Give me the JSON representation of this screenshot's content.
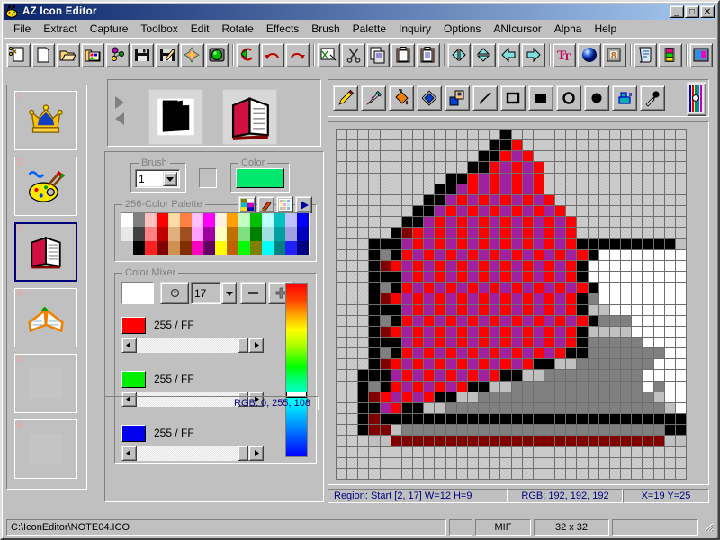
{
  "window": {
    "title": "AZ Icon Editor",
    "icon": "palette-bug-icon",
    "minimize_label": "_",
    "maximize_label": "□",
    "close_label": "✕"
  },
  "menubar": {
    "items": [
      {
        "label": "File",
        "accel": "F"
      },
      {
        "label": "Extract",
        "accel": "x"
      },
      {
        "label": "Capture",
        "accel": "C"
      },
      {
        "label": "Toolbox",
        "accel": "T"
      },
      {
        "label": "Edit",
        "accel": "E"
      },
      {
        "label": "Rotate",
        "accel": "R"
      },
      {
        "label": "Effects",
        "accel": "c"
      },
      {
        "label": "Brush",
        "accel": "B"
      },
      {
        "label": "Palette",
        "accel": "P"
      },
      {
        "label": "Inquiry",
        "accel": "I"
      },
      {
        "label": "Options",
        "accel": "O"
      },
      {
        "label": "ANIcursor",
        "accel": ""
      },
      {
        "label": "Alpha",
        "accel": ""
      },
      {
        "label": "Help",
        "accel": "H"
      }
    ]
  },
  "toolbar": {
    "buttons": [
      {
        "name": "new-icon-button",
        "icon": "new-doc-scissors-icon"
      },
      {
        "name": "new-file-button",
        "icon": "blank-page-icon"
      },
      {
        "name": "open-button",
        "icon": "open-folder-icon"
      },
      {
        "name": "open-library-button",
        "icon": "folder-images-icon"
      },
      {
        "name": "molecule-button",
        "icon": "molecule-icon"
      },
      {
        "name": "save-button",
        "icon": "floppy-disk-icon"
      },
      {
        "name": "save-as-button",
        "icon": "floppy-disk-pencil-icon"
      },
      {
        "name": "effects-button",
        "icon": "fireworks-icon"
      },
      {
        "name": "capture-button",
        "icon": "green-gem-icon"
      },
      {
        "name": "revert-button",
        "icon": "green-undo-arrow-icon"
      },
      {
        "name": "undo-button",
        "icon": "undo-arrow-icon"
      },
      {
        "name": "redo-button",
        "icon": "redo-arrow-icon"
      },
      {
        "name": "cut-region-button",
        "icon": "image-scissors-icon"
      },
      {
        "name": "cut-button",
        "icon": "scissors-icon"
      },
      {
        "name": "copy-button",
        "icon": "copy-pages-icon"
      },
      {
        "name": "paste-button",
        "icon": "clipboard-icon"
      },
      {
        "name": "paste-special-button",
        "icon": "clipboard-text-icon"
      },
      {
        "name": "flip-horizontal-button",
        "icon": "flip-horizontal-icon"
      },
      {
        "name": "flip-vertical-button",
        "icon": "flip-vertical-icon"
      },
      {
        "name": "rotate-left-button",
        "icon": "arrow-left-icon"
      },
      {
        "name": "rotate-right-button",
        "icon": "arrow-right-icon"
      },
      {
        "name": "text-tool-button",
        "icon": "text-tt-icon"
      },
      {
        "name": "sphere-button",
        "icon": "blue-sphere-icon"
      },
      {
        "name": "bit-depth-button",
        "icon": "eight-bit-icon"
      },
      {
        "name": "script-button",
        "icon": "scroll-icon"
      },
      {
        "name": "animation-button",
        "icon": "film-strip-icon"
      },
      {
        "name": "preview-button",
        "icon": "color-preview-icon"
      }
    ]
  },
  "thumbnails": {
    "items": [
      {
        "number": "1",
        "icon": "crown-icon",
        "selected": false,
        "empty": false
      },
      {
        "number": "2",
        "icon": "paint-palette-icon",
        "selected": false,
        "empty": false
      },
      {
        "number": "3",
        "icon": "closed-book-icon",
        "selected": true,
        "empty": false
      },
      {
        "number": "4",
        "icon": "open-book-icon",
        "selected": false,
        "empty": false
      },
      {
        "number": "5",
        "icon": "",
        "selected": false,
        "empty": true
      },
      {
        "number": "6",
        "icon": "",
        "selected": false,
        "empty": true
      }
    ]
  },
  "preview": {
    "next_label": "▶",
    "prev_label": "◀",
    "mask_name": "mask-preview",
    "image_name": "image-preview"
  },
  "brush": {
    "group_label": "Brush",
    "value": "1"
  },
  "color": {
    "group_label": "Color",
    "current_hex": "#00e96e"
  },
  "palette": {
    "group_label": "256-Color Palette",
    "buttons": [
      {
        "name": "palette-grid-button",
        "icon": "color-grid-icon"
      },
      {
        "name": "palette-pick-button",
        "icon": "brush-red-icon"
      },
      {
        "name": "palette-table-button",
        "icon": "color-table-icon"
      },
      {
        "name": "palette-next-button",
        "icon": "play-triangle-icon"
      }
    ],
    "rows": [
      [
        "#ffffff",
        "#808080",
        "#ffc0c0",
        "#ff0000",
        "#ffd8a8",
        "#ff8040",
        "#ffc0ff",
        "#ff00ff",
        "#fff0e0",
        "#ffa000",
        "#c0ffc0",
        "#00c000",
        "#c0ffff",
        "#00c0c0",
        "#c0c0ff",
        "#0000ff"
      ],
      [
        "#e8e8e8",
        "#404040",
        "#ff8080",
        "#c00000",
        "#e0b080",
        "#a05020",
        "#ffa0ff",
        "#a000a0",
        "#ffffc0",
        "#c07000",
        "#80e080",
        "#008000",
        "#a0e0e0",
        "#00a0a0",
        "#a0a0e0",
        "#0000c0"
      ],
      [
        "#c0c0c0",
        "#000000",
        "#ff2020",
        "#800000",
        "#d09050",
        "#803000",
        "#ff00c0",
        "#600060",
        "#ffff00",
        "#c06000",
        "#00ff00",
        "#808000",
        "#00ffff",
        "#008080",
        "#2020ff",
        "#000080"
      ]
    ]
  },
  "mixer": {
    "group_label": "Color Mixer",
    "swatch_hex": "#ffffff",
    "circle_button_icon": "circle-dot-icon",
    "number_value": "17",
    "dropdown_icon": "chevron-down-icon",
    "minus_label": "▬",
    "plus_label": "✚",
    "channels": [
      {
        "name": "red",
        "swatch": "#ff0000",
        "text": "255 / FF"
      },
      {
        "name": "green",
        "swatch": "#00ee00",
        "text": "255 / FF"
      },
      {
        "name": "blue",
        "swatch": "#0000ee",
        "text": "255 / FF"
      }
    ],
    "slider_left_label": "◀",
    "slider_right_label": "▶"
  },
  "draw_tools": {
    "items": [
      {
        "name": "pencil-tool",
        "icon": "pencil-icon"
      },
      {
        "name": "brush-tool",
        "icon": "paintbrush-icon"
      },
      {
        "name": "fill-tool",
        "icon": "paint-bucket-icon"
      },
      {
        "name": "gradient-tool",
        "icon": "gradient-diamond-icon"
      },
      {
        "name": "select-tool",
        "icon": "selection-square-icon"
      },
      {
        "name": "line-tool",
        "icon": "line-icon"
      },
      {
        "name": "rectangle-outline-tool",
        "icon": "rectangle-outline-icon"
      },
      {
        "name": "rectangle-filled-tool",
        "icon": "rectangle-filled-icon"
      },
      {
        "name": "ellipse-outline-tool",
        "icon": "ellipse-outline-icon"
      },
      {
        "name": "ellipse-filled-tool",
        "icon": "ellipse-filled-icon"
      },
      {
        "name": "airbrush-tool",
        "icon": "spray-can-icon"
      },
      {
        "name": "eyedropper-tool",
        "icon": "eyedropper-icon"
      }
    ],
    "side_tool": {
      "name": "color-ramp-tool",
      "icon": "color-ramp-icon"
    }
  },
  "status": {
    "mixer_rgb": "RGB: 0, 255, 108",
    "region": "Region: Start [2, 17]  W=12 H=9",
    "pixel_rgb": "RGB: 192, 192, 192",
    "coords": "X=19  Y=25"
  },
  "statusbar": {
    "path": "C:\\IconEditor\\NOTE04.ICO",
    "spacer": "",
    "format": "MIF",
    "size": "32 x 32",
    "extra": ""
  },
  "canvas": {
    "width": 32,
    "height": 32,
    "colors": {
      "t": "transparent-checker",
      "k": "#000000",
      "r": "#ff0000",
      "p": "#a020a0",
      "d": "#800000",
      "w": "#ffffff",
      "l": "#c0c0c0",
      "g": "#808080",
      "x": "#e8e8e8"
    },
    "pixels": [
      "tttttttttttttttkttttttttttttttttt",
      "ttttttttttttttkkrttttttttttttttt",
      "tttttttttttttkkrprtttttttttttttt",
      "ttttttttttttkkrprprttttttttttttt",
      "ttttttttttkkrprprprtttttttttttttt",
      "tttttttttkkprprprprttttttttttttt",
      "ttttttttkkprprprprprtttttttttttt",
      "tttttttkkprprprprprprttttttttttt",
      "ttttttkkprprprprprprprtttttttttt",
      "tttttkdrprprprprprprprtttttttttt",
      "tttkkkprprprprprprprprkkkkkkkkkl",
      "tttkgkrprprprprprprprprkwwwwwwwwk",
      "tttkdrprprprprprprprprkwwwwwwwwwk",
      "tttkkkprprprprprprprprkwwwwwwwwwk",
      "tttkgkrprprprprprprprprkwwwwwwwwk",
      "tttkdrprprprprprprprprkgwwwwwwwwk",
      "tttkkkprprprprprprprprkllwwwwwwwk",
      "tttkgkrprprprprprprprprkgggwwwwwk",
      "tttkdrprprprprprprprprkllllwwwwwk",
      "tttkkkprprprprprprprprkgggggwwwwk",
      "tttkgkrprprprprprprprkkgggggggwwk",
      "tttkdrprprprprprprkkllgggggggwwwk",
      "ttkkkprprprprprkkllgggggggggwwwwk",
      "ttkgkrprprprkkllggggggggggggwgwwk",
      "ttkdrprprkkllgggggggggggggggglwwwk",
      "ttkkprkkllgggggggggggggggggggglwk",
      "ttkdkkkkkkkkkkkkkkkkkkkkkkkkkkkkw",
      "ttkddlggggggggggggggggggggggggkkl",
      "tttlldddddddddddddddddddddddddllt",
      "tttttttttttttttttttttttttttttttt",
      "tttttttttttttttttttttttttttttttt",
      "tttttttttttttttttttttttttttttttt"
    ]
  }
}
